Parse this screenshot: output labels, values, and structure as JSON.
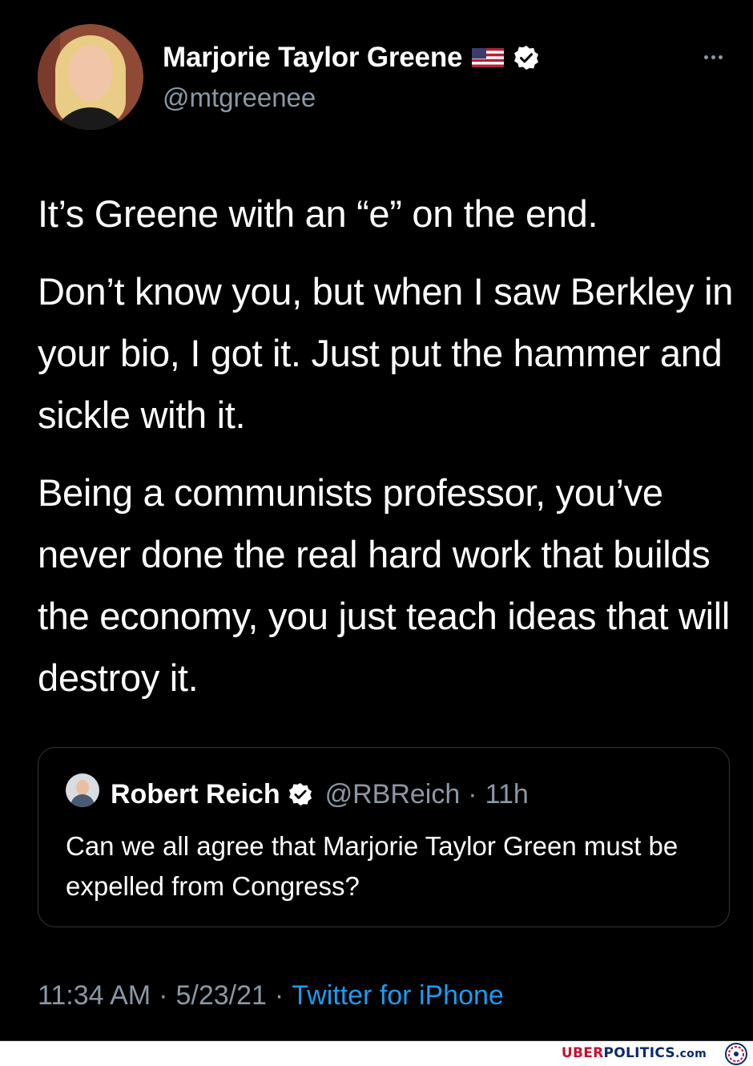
{
  "tweet": {
    "author": {
      "display_name": "Marjorie Taylor Greene",
      "handle": "@mtgreenee",
      "avatar_icon": "profile-photo",
      "flag_icon": "us-flag-icon",
      "verified_icon": "verified-badge-icon"
    },
    "more_icon": "more-options-icon",
    "paragraphs": [
      "It’s Greene with an “e” on the end.",
      "Don’t know you, but when I saw Berkley in your bio, I got it.  Just put the hammer and sickle with it.",
      "Being a communists professor, you’ve never done the real hard work that builds the economy, you just teach ideas that will destroy it."
    ],
    "quoted_tweet": {
      "display_name": "Robert Reich",
      "handle": "@RBReich",
      "separator": "·",
      "time": "11h",
      "text": "Can we all agree that Marjorie Taylor Green must be expelled from Congress?"
    },
    "meta": {
      "time": "11:34 AM",
      "separator": "·",
      "date": "5/23/21",
      "source": "Twitter for iPhone"
    }
  },
  "watermark": {
    "part1": "UBER",
    "part2": "POLITICS",
    "part3": ".com"
  },
  "colors": {
    "background": "#000000",
    "text": "#ffffff",
    "muted": "#8b98a5",
    "link": "#1d9bf0",
    "border": "#333639"
  }
}
